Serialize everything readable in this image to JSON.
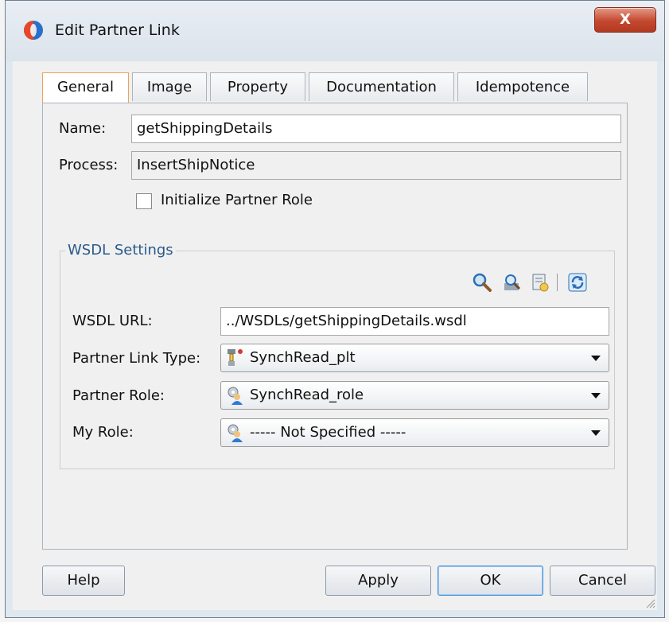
{
  "window": {
    "title": "Edit Partner Link",
    "close_label": "X"
  },
  "tabs": [
    {
      "label": "General",
      "active": true
    },
    {
      "label": "Image",
      "active": false
    },
    {
      "label": "Property",
      "active": false
    },
    {
      "label": "Documentation",
      "active": false
    },
    {
      "label": "Idempotence",
      "active": false
    }
  ],
  "general": {
    "name_label": "Name:",
    "name_value": "getShippingDetails",
    "process_label": "Process:",
    "process_value": "InsertShipNotice",
    "init_partner_role_label": "Initialize Partner Role",
    "init_partner_role_checked": false
  },
  "wsdl": {
    "group_title": "WSDL Settings",
    "toolbar_icons": [
      "search-icon",
      "browse-services-icon",
      "service-explorer-icon",
      "refresh-icon"
    ],
    "url_label": "WSDL URL:",
    "url_value": "../WSDLs/getShippingDetails.wsdl",
    "plt_label": "Partner Link Type:",
    "plt_value": "SynchRead_plt",
    "partner_role_label": "Partner Role:",
    "partner_role_value": "SynchRead_role",
    "my_role_label": "My Role:",
    "my_role_value": "----- Not Specified -----"
  },
  "buttons": {
    "help": "Help",
    "apply": "Apply",
    "ok": "OK",
    "cancel": "Cancel"
  },
  "colors": {
    "accent_tab": "#e8a65a",
    "group_title": "#2b5a8a",
    "close": "#c4482f"
  }
}
